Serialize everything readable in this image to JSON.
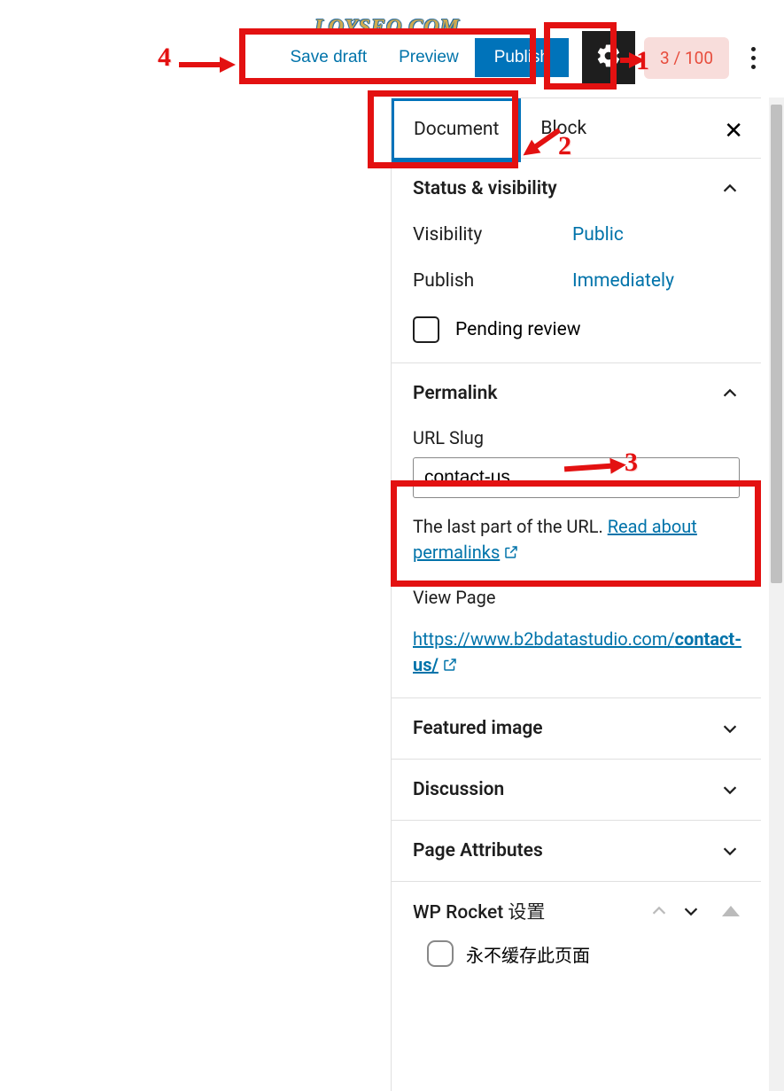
{
  "watermark": "LOYSEO.COM",
  "toolbar": {
    "save_draft": "Save draft",
    "preview": "Preview",
    "publish": "Publish",
    "score": "3 / 100"
  },
  "annotations": {
    "n1": "1",
    "n2": "2",
    "n3": "3",
    "n4": "4"
  },
  "tabs": {
    "document": "Document",
    "block": "Block"
  },
  "status": {
    "title": "Status & visibility",
    "visibility_label": "Visibility",
    "visibility_value": "Public",
    "publish_label": "Publish",
    "publish_value": "Immediately",
    "pending": "Pending review"
  },
  "permalink": {
    "title": "Permalink",
    "slug_label": "URL Slug",
    "slug_value": "contact-us",
    "help_pre": "The last part of the URL. ",
    "help_link": "Read about permalinks",
    "view_page": "View Page",
    "url_prefix": "https://www.b2bdatastudio.com/",
    "url_slug_bold": "contact-us/"
  },
  "featured": {
    "title": "Featured image"
  },
  "discussion": {
    "title": "Discussion"
  },
  "page_attr": {
    "title": "Page Attributes"
  },
  "wprocket": {
    "title": "WP Rocket 设置",
    "nocache": "永不缓存此页面"
  }
}
